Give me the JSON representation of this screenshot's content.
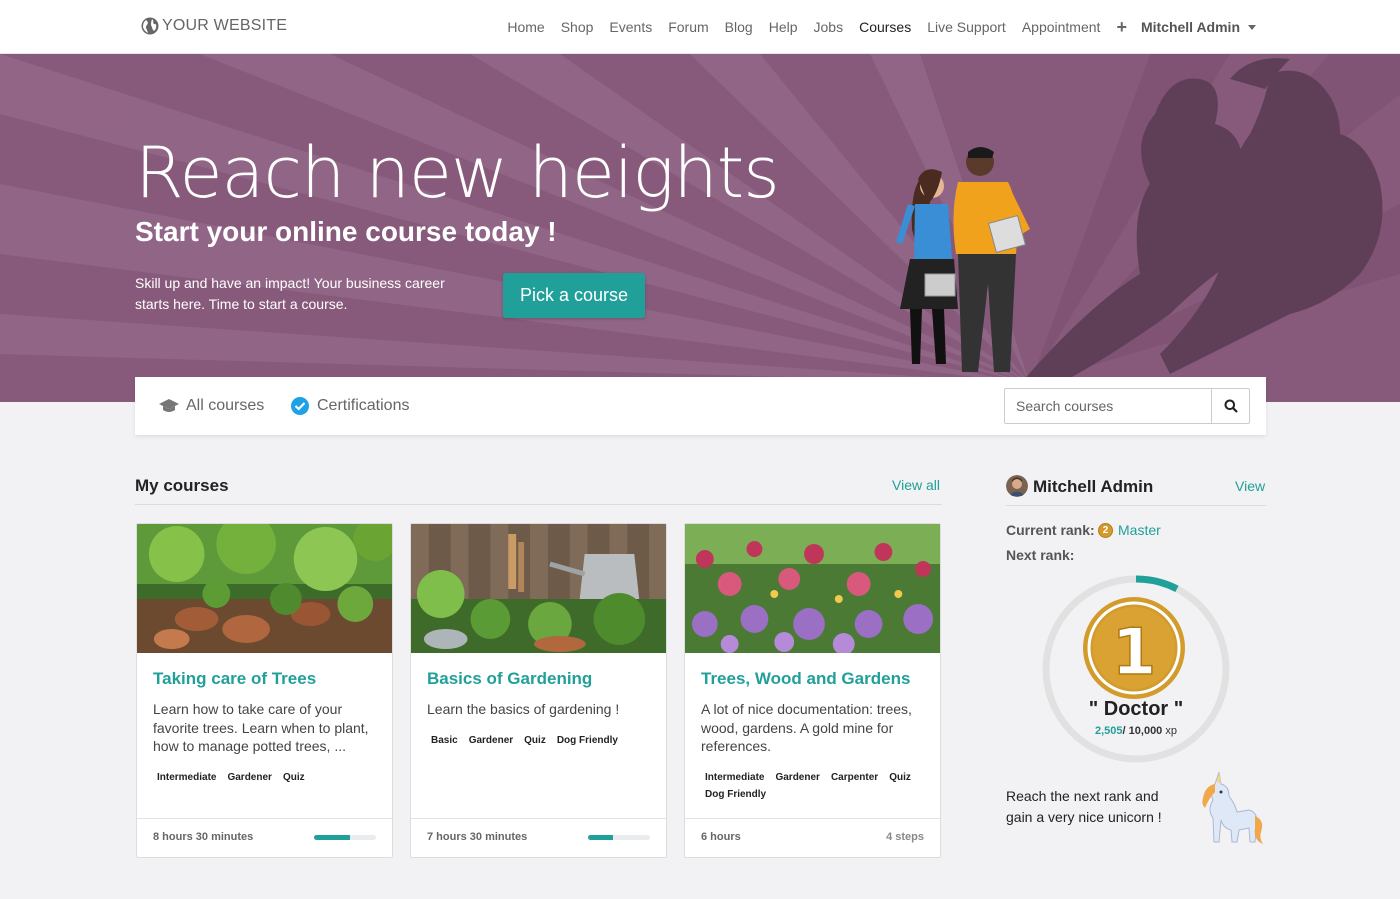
{
  "navbar": {
    "logo": "YOUR WEBSITE",
    "items": [
      "Home",
      "Shop",
      "Events",
      "Forum",
      "Blog",
      "Help",
      "Jobs",
      "Courses",
      "Live Support",
      "Appointment"
    ],
    "active": "Courses",
    "plus": "+",
    "user": "Mitchell Admin"
  },
  "hero": {
    "title": "Reach new heights",
    "subtitle": "Start your online course today !",
    "text": "Skill up and have an impact! Your business career starts here. Time to start a course.",
    "button": "Pick a course",
    "background_color": "#875a7b"
  },
  "filters": {
    "all_courses": "All courses",
    "certifications": "Certifications",
    "search_placeholder": "Search courses"
  },
  "my_courses": {
    "title": "My courses",
    "view_all": "View all",
    "cards": [
      {
        "title": "Taking care of Trees",
        "description": "Learn how to take care of your favorite trees. Learn when to plant, how to manage potted trees, ...",
        "tags": [
          "Intermediate",
          "Gardener",
          "Quiz"
        ],
        "duration": "8 hours 30 minutes",
        "progress": 0.58
      },
      {
        "title": "Basics of Gardening",
        "description": "Learn the basics of gardening !",
        "tags": [
          "Basic",
          "Gardener",
          "Quiz",
          "Dog Friendly"
        ],
        "duration": "7 hours 30 minutes",
        "progress": 0.4
      },
      {
        "title": "Trees, Wood and Gardens",
        "description": "A lot of nice documentation: trees, wood, gardens. A gold mine for references.",
        "tags": [
          "Intermediate",
          "Gardener",
          "Carpenter",
          "Quiz",
          "Dog Friendly"
        ],
        "duration": "6 hours",
        "steps": "4 steps"
      }
    ]
  },
  "profile": {
    "name": "Mitchell Admin",
    "view": "View",
    "current_rank_label": "Current rank:",
    "current_rank_badge": "2",
    "current_rank": "Master",
    "next_rank_label": "Next rank:",
    "next_rank_badge": "1",
    "next_rank_name": "\" Doctor \"",
    "xp_current": "2,505",
    "xp_total": "10,000",
    "xp_unit": "xp",
    "reach_text": "Reach the next rank and gain a very nice unicorn !",
    "accent": "#21a09a"
  }
}
